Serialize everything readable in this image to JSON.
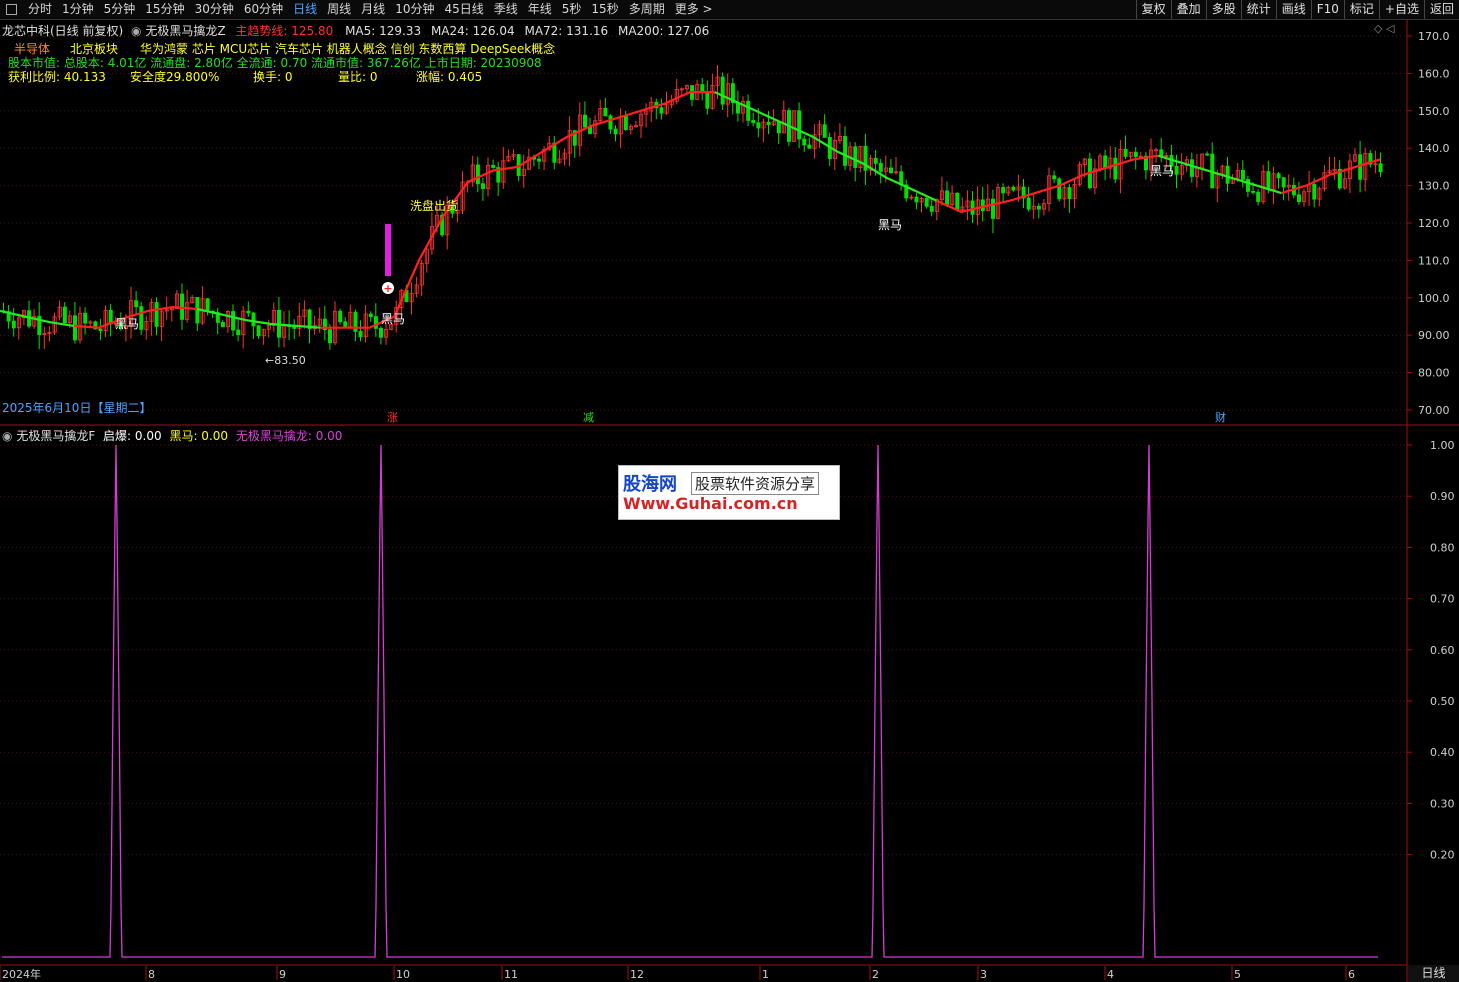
{
  "toolbar": {
    "periods": [
      "分时",
      "1分钟",
      "5分钟",
      "15分钟",
      "30分钟",
      "60分钟",
      "日线",
      "周线",
      "月线",
      "10分钟",
      "45日线",
      "季线",
      "年线",
      "5秒",
      "15秒",
      "多周期",
      "更多 >"
    ],
    "active_period": "日线",
    "tools": [
      "复权",
      "叠加",
      "多股",
      "统计",
      "画线",
      "F10",
      "标记",
      "+自选",
      "返回"
    ]
  },
  "main_chart": {
    "stock_title": "龙芯中科(日线 前复权)",
    "indicator_name": "无极黑马擒龙Z",
    "main_trend_label": "主趋势线: 125.80",
    "ma_values": [
      "MA5: 129.33",
      "MA24: 126.04",
      "MA72: 131.16",
      "MA200: 127.06"
    ],
    "sector_row": [
      "半导体",
      "北京板块",
      "华为鸿蒙 芯片 MCU芯片 汽车芯片 机器人概念 信创 东数西算 DeepSeek概念"
    ],
    "info_row": "股本市值: 总股本: 4.01亿 流通盘: 2.80亿 全流通: 0.70 流通市值: 367.26亿 上市日期: 20230908",
    "stats_row": [
      "获利比例: 40.133",
      "安全度29.800%",
      "换手: 0",
      "量比: 0",
      "涨幅: 0.405"
    ],
    "date_label": "2025年6月10日【星期二】",
    "annotations": {
      "heima": "黑马",
      "low_price": "←83.50",
      "wash": "洗盘出货",
      "zhang": "涨",
      "jian": "减",
      "cai": "财"
    },
    "price_axis": [
      "170.0",
      "160.0",
      "150.0",
      "140.0",
      "130.0",
      "120.0",
      "110.0",
      "100.0",
      "90.00",
      "80.00",
      "70.00"
    ],
    "colors": {
      "up": "#ff3232",
      "down": "#00e000",
      "trend_up": "#ff2020",
      "trend_down": "#22ee22",
      "signal": "#e020e0",
      "yellow": "#ffff00"
    }
  },
  "sub_chart": {
    "indicator_name": "无极黑马擒龙F",
    "values": [
      {
        "label": "启爆: 0.00",
        "color": "#ffffff"
      },
      {
        "label": "黑马: 0.00",
        "color": "#ffff00"
      },
      {
        "label": "无极黑马擒龙: 0.00",
        "color": "#e040e0"
      }
    ],
    "value_axis": [
      "1.00",
      "0.90",
      "0.80",
      "0.70",
      "0.60",
      "0.50",
      "0.40",
      "0.30",
      "0.20"
    ]
  },
  "time_axis": [
    "2024年",
    "8",
    "9",
    "10",
    "11",
    "12",
    "1",
    "2",
    "3",
    "4",
    "5",
    "6"
  ],
  "bottom_tab": "日线",
  "watermark": {
    "logo": "股海网",
    "tagline": "股票软件资源分享",
    "url": "Www.Guhai.com.cn"
  },
  "chart_data": [
    {
      "type": "line",
      "title": "主趋势线",
      "x": [
        0,
        10,
        20,
        30,
        40,
        50,
        60,
        70,
        80,
        90,
        100,
        110,
        120,
        130,
        140,
        150,
        160,
        170,
        180,
        190,
        200,
        210,
        220,
        230,
        240,
        250,
        260,
        270,
        280,
        290,
        300,
        310,
        320,
        330,
        340,
        350,
        360,
        370,
        380,
        390,
        400,
        410,
        420,
        430,
        440,
        450,
        460,
        470,
        480,
        490,
        500,
        510,
        520,
        530,
        540,
        550,
        560
      ],
      "values": [
        96.5,
        95,
        93.5,
        92.5,
        92,
        94.5,
        96.5,
        97.5,
        97,
        95.5,
        94,
        93,
        92.5,
        92,
        92,
        92,
        95,
        110,
        122,
        131,
        134,
        135,
        139,
        143,
        146,
        148,
        150,
        152,
        155,
        155,
        152,
        149,
        146,
        143,
        139,
        136,
        132,
        129,
        126,
        123,
        124.5,
        126,
        128,
        130,
        133,
        135,
        137,
        138,
        136,
        134,
        132,
        130,
        128,
        130,
        133,
        135,
        137
      ],
      "ylim": [
        70,
        170
      ]
    },
    {
      "type": "line",
      "title": "无极黑马擒龙F",
      "series": [
        {
          "name": "无极黑马擒龙",
          "values": [
            0,
            1,
            0,
            0,
            1,
            0,
            0,
            1,
            0,
            1,
            0
          ]
        }
      ],
      "ylim": [
        0,
        1
      ]
    }
  ]
}
